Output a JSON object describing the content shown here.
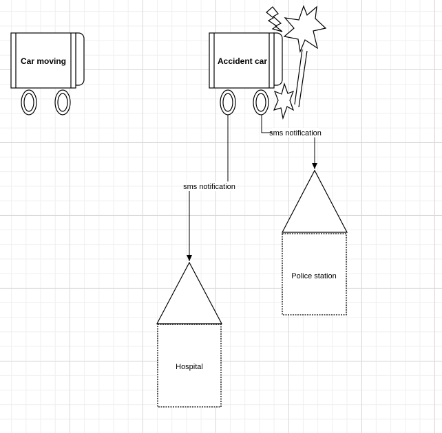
{
  "diagram": {
    "nodes": {
      "car_moving": {
        "label": "Car moving"
      },
      "accident_car": {
        "label": "Accident car"
      },
      "hospital": {
        "label": "Hospital"
      },
      "police_station": {
        "label": "Police station"
      }
    },
    "edges": {
      "to_hospital": {
        "label": "sms notification"
      },
      "to_police": {
        "label": "sms notification"
      }
    }
  }
}
